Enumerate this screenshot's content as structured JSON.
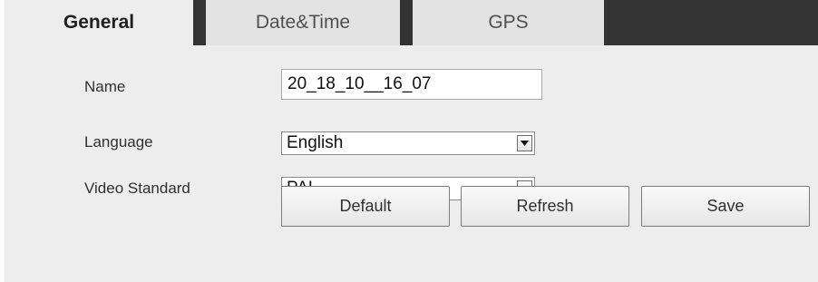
{
  "tabs": {
    "general": "General",
    "datetime": "Date&Time",
    "gps": "GPS"
  },
  "form": {
    "name": {
      "label": "Name",
      "value": "20_18_10__16_07"
    },
    "language": {
      "label": "Language",
      "value": "English"
    },
    "video_standard": {
      "label": "Video Standard",
      "value": "PAL"
    }
  },
  "buttons": {
    "default": "Default",
    "refresh": "Refresh",
    "save": "Save"
  },
  "icons": {
    "select_arrow": "chevron-down-icon"
  },
  "colors": {
    "tab_bar_dark": "#333333",
    "active_tab": "#ededed",
    "inactive_tab": "#e3e3e3",
    "panel": "#ededed"
  }
}
